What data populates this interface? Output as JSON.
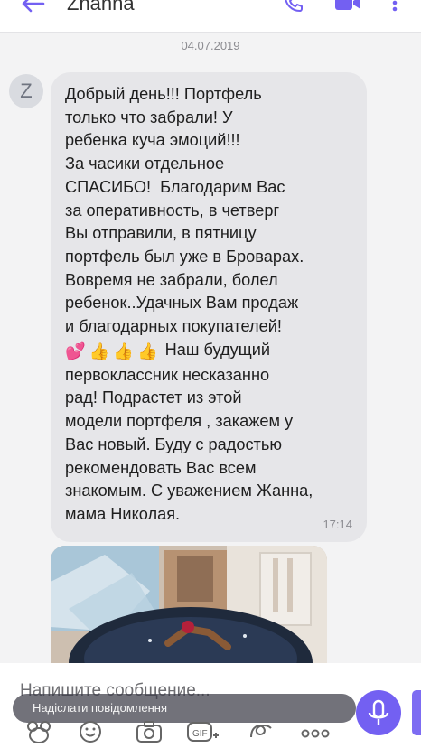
{
  "header": {
    "contact_name": "Zhanna",
    "icons": [
      "back-arrow-icon",
      "call-icon",
      "video-call-icon",
      "more-vert-icon"
    ]
  },
  "chat": {
    "date": "04.07.2019",
    "avatar_letter": "Z",
    "message": {
      "text_part1": "Добрый день!!! Портфель\nтолько что забрали! У\nребенка куча эмоций!!!\nЗа часики отдельное\nСПАСИБО!  Благодарим Вас\nза оперативность, в четверг\nВы отправили, в пятницу\nпортфель был уже в Броварах.\nВовремя не забрали, болел\nребенок..Удачных Вам продаж\nи благодарных покупателей!",
      "emojis": [
        "💕",
        "👍",
        "👍",
        "👍"
      ],
      "text_part2": "Наш будущий\nпервоклассник несказанно\nрад! Подрастет из этой\nмодели портфеля , закажем у\nВас новый. Буду с радостью\nрекомендовать Вас всем\nзнакомым. С уважением Жанна,\nмама Николая.",
      "time": "17:14"
    },
    "photo_icon": "image-icon"
  },
  "composer": {
    "placeholder": "Напишите сообщение...",
    "translate_label": "Надіслати повідомлення",
    "toolbar_icons": [
      "sticker-icon",
      "emoji-icon",
      "camera-icon",
      "gif-icon",
      "doodle-icon",
      "more-icon"
    ]
  },
  "colors": {
    "accent": "#7360f2",
    "bubble": "#e6e6e9",
    "background": "#f3f3f4"
  }
}
